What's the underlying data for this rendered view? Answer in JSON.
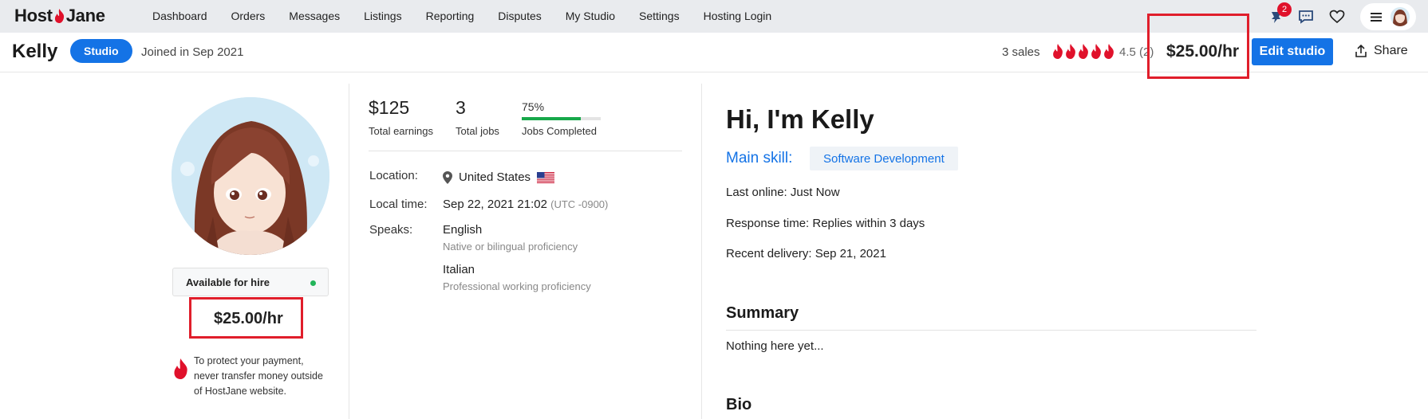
{
  "brand": {
    "name_left": "Host",
    "name_right": "Jane",
    "accent": "#e0112b"
  },
  "nav": {
    "items": [
      "Dashboard",
      "Orders",
      "Messages",
      "Listings",
      "Reporting",
      "Disputes",
      "My Studio",
      "Settings",
      "Hosting Login"
    ],
    "notification_count": "2",
    "icons": [
      "pin-icon",
      "chat-icon",
      "heart-icon",
      "hamburger-icon",
      "user-avatar"
    ]
  },
  "profile_bar": {
    "name": "Kelly",
    "badge": "Studio",
    "joined": "Joined in Sep 2021",
    "sales": "3 sales",
    "rating_stars": 5,
    "rating_text": "4.5 (2)",
    "rate": "$25.00/hr",
    "edit_label": "Edit studio",
    "share_label": "Share",
    "primary_color": "#1473e6"
  },
  "left": {
    "availability": "Available for hire",
    "availability_color": "#22b55a",
    "rate": "$25.00/hr",
    "protect_text": "To protect your payment, never transfer money outside of HostJane website."
  },
  "stats": {
    "earnings_value": "$125",
    "earnings_label": "Total earnings",
    "jobs_value": "3",
    "jobs_label": "Total jobs",
    "completed_value": "75%",
    "completed_fraction": 0.75,
    "completed_label": "Jobs Completed"
  },
  "info": {
    "location_label": "Location:",
    "location_value": "United States",
    "local_time_label": "Local time:",
    "local_time_value": "Sep 22, 2021 21:02",
    "utc": "(UTC -0900)",
    "speaks_label": "Speaks:",
    "languages": [
      {
        "name": "English",
        "level": "Native or bilingual proficiency"
      },
      {
        "name": "Italian",
        "level": "Professional working proficiency"
      }
    ]
  },
  "about": {
    "greeting": "Hi, I'm Kelly",
    "main_skill_label": "Main skill:",
    "main_skill": "Software Development",
    "last_online": "Last online: Just Now",
    "response_time": "Response time: Replies within 3 days",
    "recent_delivery": "Recent delivery: Sep 21, 2021",
    "summary_title": "Summary",
    "summary_text": "Nothing here yet...",
    "bio_title": "Bio"
  }
}
